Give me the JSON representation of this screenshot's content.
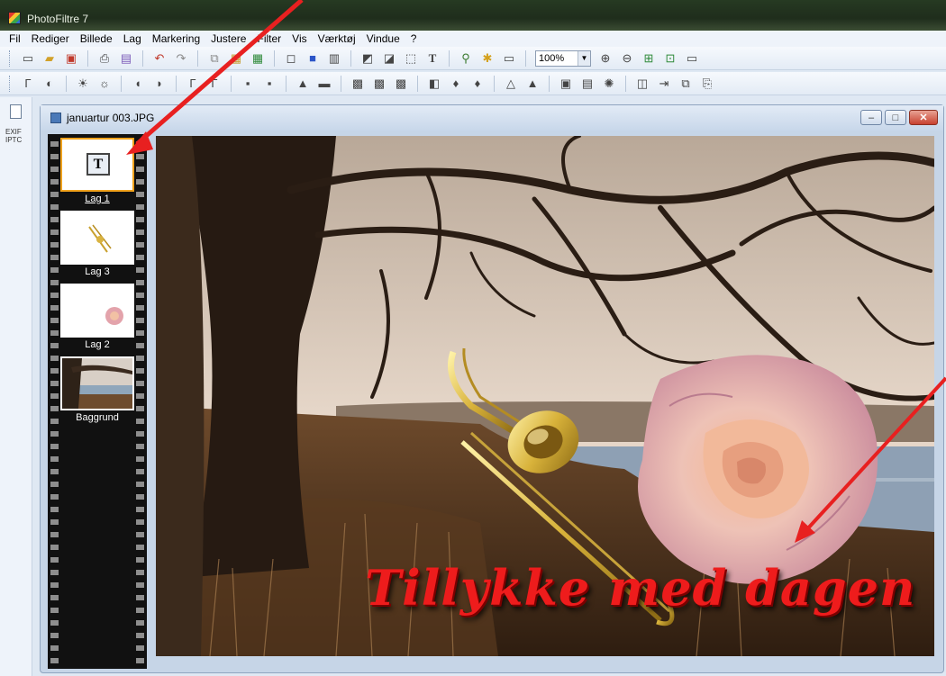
{
  "app": {
    "title": "PhotoFiltre 7"
  },
  "menu": [
    "Fil",
    "Rediger",
    "Billede",
    "Lag",
    "Markering",
    "Justere",
    "Filter",
    "Vis",
    "Værktøj",
    "Vindue",
    "?"
  ],
  "toolbar": {
    "zoom": "100%"
  },
  "leftpanel": {
    "exif_label": "EXIF IPTC"
  },
  "document": {
    "filename": "januartur 003.JPG",
    "minimize": "–",
    "maximize": "□",
    "close": "✕"
  },
  "layers": [
    {
      "name": "Lag 1",
      "type": "text",
      "active": true
    },
    {
      "name": "Lag 3",
      "type": "image",
      "active": false
    },
    {
      "name": "Lag 2",
      "type": "image",
      "active": false
    },
    {
      "name": "Baggrund",
      "type": "background",
      "active": false
    }
  ],
  "canvas": {
    "greeting": "Tillykke med dagen",
    "greeting_color": "#ee1c1c"
  },
  "annotation": {
    "arrow_color": "#e82020"
  }
}
